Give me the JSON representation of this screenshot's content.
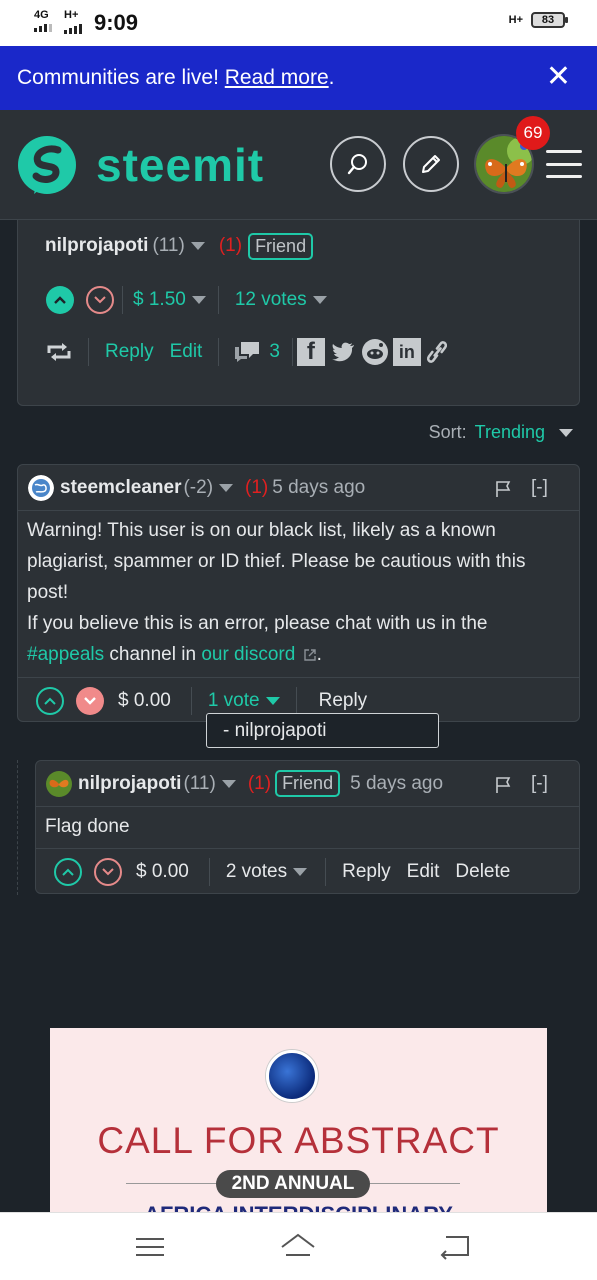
{
  "status_bar": {
    "network1": "4G",
    "network2": "H+",
    "time": "9:09",
    "network3": "H+",
    "battery": "83"
  },
  "banner": {
    "text": "Communities are live! ",
    "link": "Read more",
    "suffix": "."
  },
  "header": {
    "logo_text": "steemit",
    "notification_count": "69"
  },
  "post": {
    "author": "nilprojapoti",
    "reputation": "(11)",
    "flag_count": "(1)",
    "friend_label": "Friend",
    "payout": "$ 1.50",
    "votes": "12 votes",
    "reply_label": "Reply",
    "edit_label": "Edit",
    "comment_count": "3"
  },
  "sort": {
    "label": "Sort:",
    "value": "Trending"
  },
  "comments": [
    {
      "author": "steemcleaner",
      "reputation": "(-2)",
      "flag_count": "(1)",
      "time": "5 days ago",
      "collapse": "[-]",
      "body_line1": "Warning! This user is on our black list, likely as a known",
      "body_line2": "plagiarist, spammer or ID thief. Please be cautious with this",
      "body_line3": "post!",
      "body_line4": "If you believe this is an error, please chat with us in the",
      "body_link1": "#appeals",
      "body_mid": " channel in ",
      "body_link2": "our discord",
      "body_end": ".",
      "payout": "$ 0.00",
      "votes": "1 vote",
      "reply_label": "Reply",
      "voter_tooltip": "- nilprojapoti"
    },
    {
      "author": "nilprojapoti",
      "reputation": "(11)",
      "flag_count": "(1)",
      "friend_label": "Friend",
      "time": "5 days ago",
      "collapse": "[-]",
      "body": "Flag done",
      "payout": "$ 0.00",
      "votes": "2 votes",
      "reply_label": "Reply",
      "edit_label": "Edit",
      "delete_label": "Delete"
    }
  ],
  "ad": {
    "title": "CALL FOR ABSTRACT",
    "pill": "2ND ANNUAL",
    "subtitle": "AFRICA INTERDISCIPLINARY"
  },
  "colors": {
    "accent": "#1fc9a8",
    "banner": "#1a28c9",
    "background": "#1d2329",
    "card": "#2c3136",
    "flag_red": "#e02020"
  }
}
